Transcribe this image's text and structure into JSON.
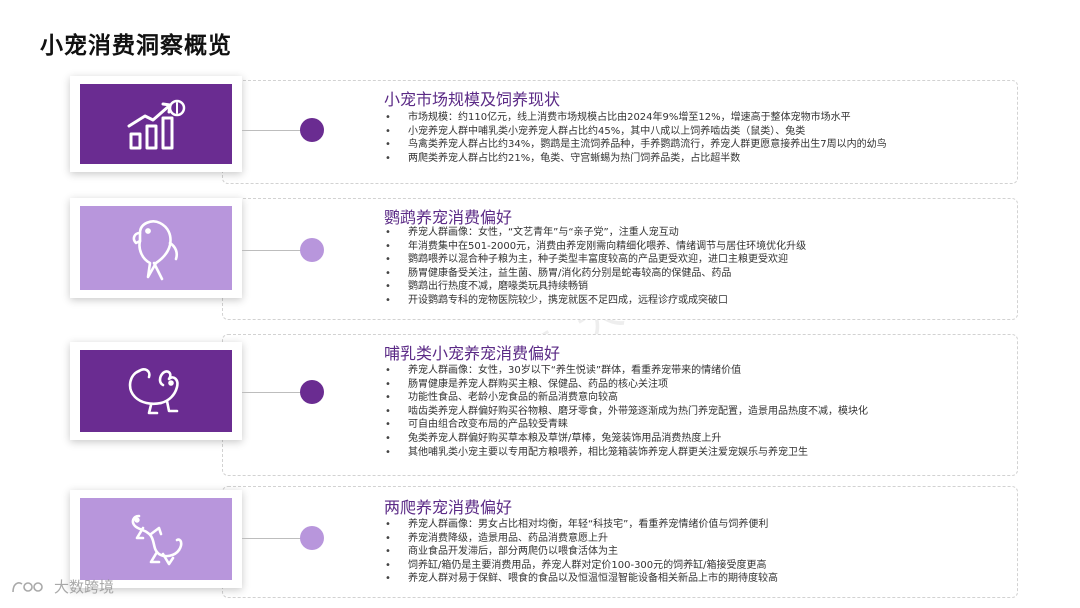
{
  "page_title": "小宠消费洞察概览",
  "colors": {
    "accent_dark": "#6a2c91",
    "accent_mid": "#8e5bb8",
    "accent_light": "#b896dc",
    "title_text": "#5b2a86"
  },
  "sections": [
    {
      "title": "小宠市场规模及饲养现状",
      "icon": "growth-chart-icon",
      "bullets": [
        "市场规模：约110亿元，线上消费市场规模占比由2024年9%增至12%，增速高于整体宠物市场水平",
        "小宠养宠人群中哺乳类小宠养宠人群占比约45%，其中八成以上饲养啮齿类（鼠类）、兔类",
        "鸟禽类养宠人群占比约34%，鹦鹉是主流饲养品种，手养鹦鹉流行，养宠人群更愿意接养出生7周以内的幼鸟",
        "两爬类养宠人群占比约21%，龟类、守宫蜥蜴为热门饲养品类，占比超半数"
      ]
    },
    {
      "title": "鹦鹉养宠消费偏好",
      "icon": "parrot-icon",
      "bullets": [
        "养宠人群画像：女性，“文艺青年”与“亲子党”，注重人宠互动",
        "年消费集中在501-2000元，消费由养宠刚需向精细化喂养、情绪调节与居住环境优化升级",
        "鹦鹉喂养以混合种子粮为主，种子类型丰富度较高的产品更受欢迎，进口主粮更受欢迎",
        "肠胃健康备受关注，益生菌、肠胃/消化药分别是蛇毒较高的保健品、药品",
        "鹦鹉出行热度不减，磨喙类玩具持续畅销",
        "开设鹦鹉专科的宠物医院较少，携宠就医不足四成，远程诊疗或成突破口"
      ]
    },
    {
      "title": "哺乳类小宠养宠消费偏好",
      "icon": "chinchilla-icon",
      "bullets": [
        "养宠人群画像：女性，30岁以下“养生悦读”群体，看重养宠带来的情绪价值",
        "肠胃健康是养宠人群购买主粮、保健品、药品的核心关注项",
        "功能性食品、老龄小宠食品的新品消费意向较高",
        "啮齿类养宠人群偏好购买谷物粮、磨牙零食，外带笼逐渐成为热门养宠配置，造景用品热度不减，模块化",
        "可自由组合改变布局的产品较受青睐",
        "兔类养宠人群偏好购买草本粮及草饼/草棒，兔笼装饰用品消费热度上升",
        "其他哺乳类小宠主要以专用配方粮喂养，相比笼箱装饰养宠人群更关注爱宠娱乐与养宠卫生"
      ]
    },
    {
      "title": "两爬养宠消费偏好",
      "icon": "gecko-icon",
      "bullets": [
        "养宠人群画像：男女占比相对均衡，年轻“科技宅”，看重养宠情绪价值与饲养便利",
        "养宠消费降级，造景用品、药品消费意愿上升",
        "商业食品开发滞后，部分两爬仍以喂食活体为主",
        "饲养缸/箱仍是主要消费用品，养宠人群对定价100-300元的饲养缸/箱接受度更高",
        "养宠人群对易于保鲜、喂食的食品以及恒温恒湿智能设备相关新品上市的期待度较高"
      ]
    }
  ],
  "watermark": "亿欧智库 大数跨境",
  "footer_logo": "大数跨境"
}
